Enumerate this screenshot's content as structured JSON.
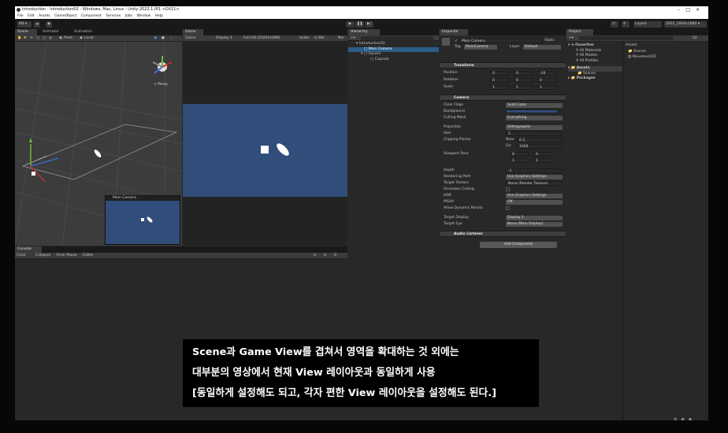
{
  "window": {
    "title": "Introduction - Introduction02 - Windows, Mac, Linux - Unity 2022.1.0f1 <DX11>",
    "menu": [
      "File",
      "Edit",
      "Assets",
      "GameObject",
      "Component",
      "Services",
      "Jobs",
      "Window",
      "Help"
    ]
  },
  "toolbar": {
    "account": "KN ▾",
    "layers": "Layers",
    "layout": "2022_1920x1080 ▾"
  },
  "scene_panel": {
    "tabs": [
      "Scene",
      "Animator",
      "Animation"
    ],
    "pivot": "Pivot",
    "local": "Local",
    "persp_label": "< Persp"
  },
  "camera_preview": {
    "title": "Main Camera"
  },
  "game_panel": {
    "tab": "Game",
    "game_dd": "Game",
    "display": "Display 1",
    "resolution": "Full HD (1920x1080)",
    "scale_label": "Scale",
    "scale_value": "0.38x",
    "play_mode": "Nor"
  },
  "console_panel": {
    "tab": "Console",
    "buttons": [
      "Clear",
      "Collapse",
      "Error Pause",
      "Editor"
    ],
    "counts": [
      "0",
      "0",
      "0"
    ]
  },
  "hierarchy": {
    "tab": "Hierarchy",
    "items": [
      {
        "label": "Introduction02",
        "indent": 0,
        "selected": false
      },
      {
        "label": "Main Camera",
        "indent": 1,
        "selected": true
      },
      {
        "label": "Square",
        "indent": 1,
        "selected": false
      },
      {
        "label": "Capsule",
        "indent": 2,
        "selected": false
      }
    ]
  },
  "inspector": {
    "tab": "Inspector",
    "object_name": "Main Camera",
    "static_label": "Static",
    "tag_label": "Tag",
    "tag_value": "MainCamera",
    "layer_label": "Layer",
    "layer_value": "Default",
    "transform": {
      "header": "Transform",
      "position": {
        "label": "Position",
        "x": "0",
        "y": "0",
        "z": "-10"
      },
      "rotation": {
        "label": "Rotation",
        "x": "0",
        "y": "0",
        "z": "0"
      },
      "scale": {
        "label": "Scale",
        "x": "1",
        "y": "1",
        "z": "1"
      }
    },
    "camera": {
      "header": "Camera",
      "clear_flags": {
        "label": "Clear Flags",
        "value": "Solid Color"
      },
      "background": {
        "label": "Background"
      },
      "culling_mask": {
        "label": "Culling Mask",
        "value": "Everything"
      },
      "projection": {
        "label": "Projection",
        "value": "Orthographic"
      },
      "size": {
        "label": "Size",
        "value": "5"
      },
      "clipping": {
        "label": "Clipping Planes",
        "near_label": "Near",
        "near": "0.3",
        "far_label": "Far",
        "far": "1000"
      },
      "viewport": {
        "label": "Viewport Rect",
        "x": "0",
        "y": "0",
        "w": "1",
        "h": "1"
      },
      "depth": {
        "label": "Depth",
        "value": "-1"
      },
      "rendering_path": {
        "label": "Rendering Path",
        "value": "Use Graphics Settings"
      },
      "target_texture": {
        "label": "Target Texture",
        "value": "None (Render Texture)"
      },
      "occlusion": {
        "label": "Occlusion Culling"
      },
      "hdr": {
        "label": "HDR",
        "value": "Use Graphics Settings"
      },
      "msaa": {
        "label": "MSAA",
        "value": "Off"
      },
      "dynamic_res": {
        "label": "Allow Dynamic Resolu"
      },
      "target_display": {
        "label": "Target Display",
        "value": "Display 1"
      },
      "target_eye": {
        "label": "Target Eye",
        "value": "None (Main Display)"
      }
    },
    "audio": {
      "header": "Audio Listener"
    },
    "add_component": "Add Component"
  },
  "project": {
    "tab": "Project",
    "favorites_label": "Favorites",
    "favorites": [
      "All Materials",
      "All Models",
      "All Prefabs"
    ],
    "assets_label": "Assets",
    "assets_children": [
      "Scenes"
    ],
    "packages_label": "Packages",
    "right_title": "Assets",
    "right_items": [
      "Scenes",
      "Movement2D"
    ],
    "hidden_count": "22"
  },
  "subtitle": {
    "line1": "Scene과 Game View를 겹쳐서 영역을 확대하는 것 외에는",
    "line2": "대부분의 영상에서 현재 View 레이아웃과 동일하게 사용",
    "line3": "[동일하게 설정해도 되고, 각자 편한 View 레이아웃을 설정해도 된다.]"
  },
  "colors": {
    "game_bg": "#314d79",
    "selection": "#2c5d87",
    "accent": "#4a90d9"
  }
}
